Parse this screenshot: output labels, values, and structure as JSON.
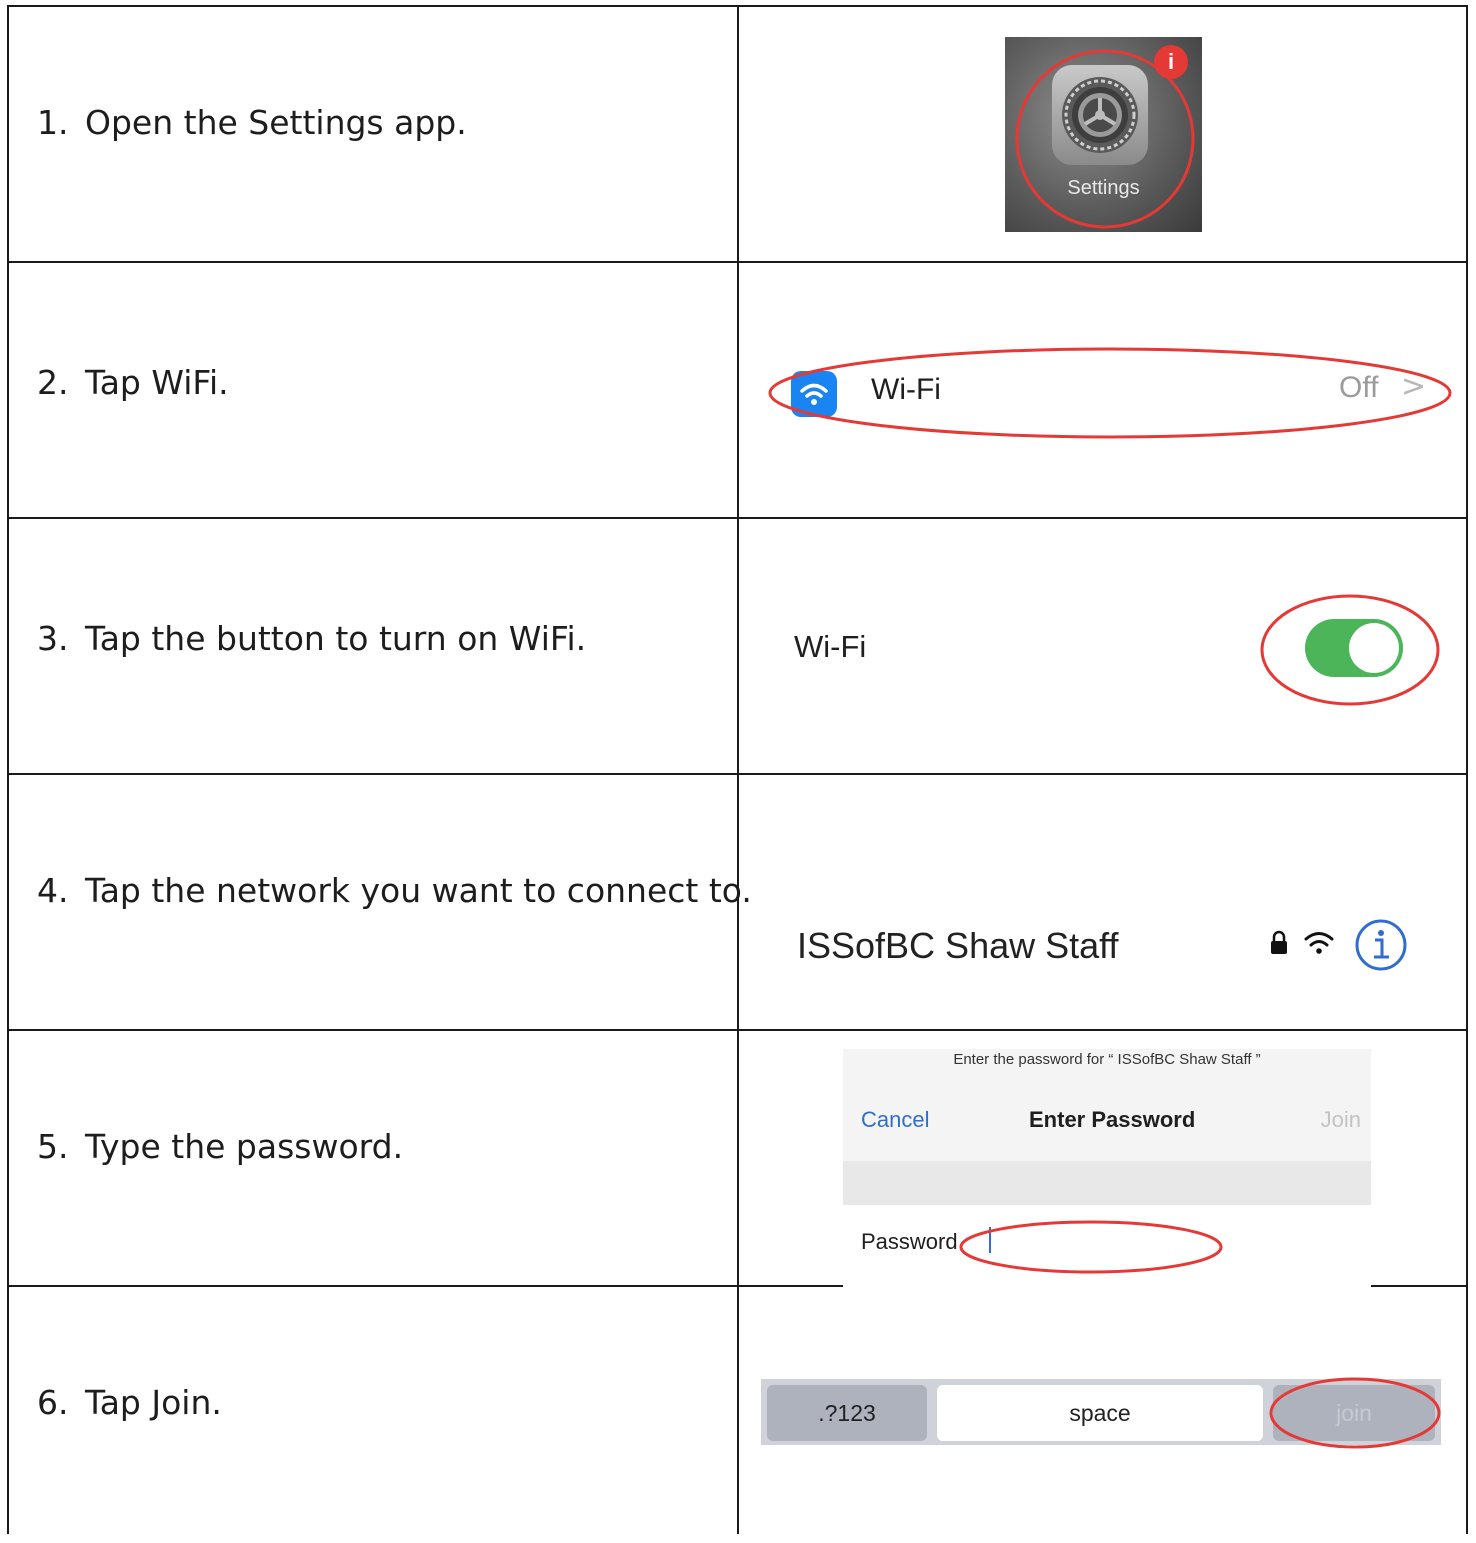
{
  "steps": [
    {
      "number": "1.",
      "text": "Open the Settings app."
    },
    {
      "number": "2.",
      "text": "Tap WiFi."
    },
    {
      "number": "3.",
      "text": "Tap the button to turn on WiFi."
    },
    {
      "number": "4.",
      "text": "Tap the network you want to connect to."
    },
    {
      "number": "5.",
      "text": "Type the password."
    },
    {
      "number": "6.",
      "text": "Tap Join."
    }
  ],
  "settings_icon": {
    "label": "Settings",
    "badge": "i",
    "icon": "gear-icon"
  },
  "wifi_row": {
    "label": "Wi-Fi",
    "value": "Off",
    "chevron": ">",
    "icon": "wifi-icon"
  },
  "wifi_toggle": {
    "label": "Wi-Fi",
    "state": "on",
    "color": "#4cb559"
  },
  "network": {
    "name": "ISSofBC Shaw Staff",
    "icons": [
      "lock-icon",
      "wifi-icon",
      "info-icon"
    ]
  },
  "password_dialog": {
    "prompt": "Enter the password for “ ISSofBC Shaw Staff ”",
    "cancel": "Cancel",
    "title": "Enter Password",
    "join": "Join",
    "field_label": "Password"
  },
  "keyboard": {
    "numbers_key": ".?123",
    "space_key": "space",
    "join_key": "join"
  },
  "highlight_color": "#e53935"
}
